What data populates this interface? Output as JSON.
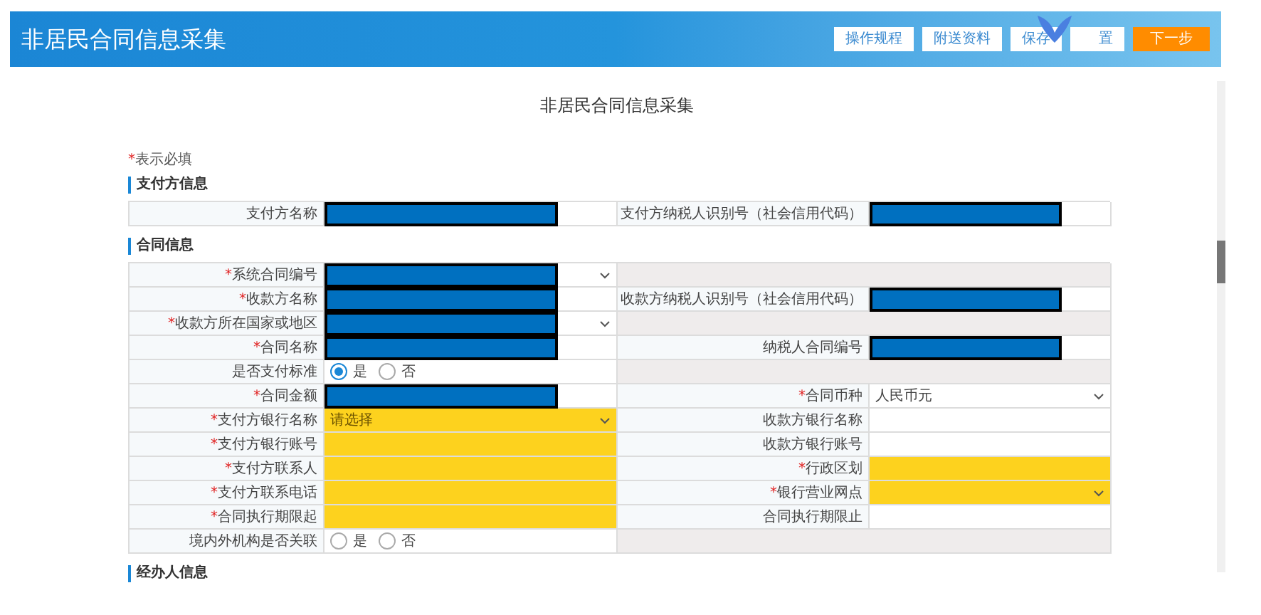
{
  "header": {
    "title": "非居民合同信息采集",
    "buttons": [
      {
        "label": "操作规程",
        "kind": "plain"
      },
      {
        "label": "附送资料",
        "kind": "plain"
      },
      {
        "label": "保存",
        "kind": "plain"
      },
      {
        "label": "置",
        "kind": "covered"
      },
      {
        "label": "下一步",
        "kind": "primary"
      }
    ]
  },
  "page_title": "非居民合同信息采集",
  "required_note": {
    "mark": "*",
    "text": "表示必填"
  },
  "sections": [
    {
      "title": "支付方信息",
      "rows": [
        [
          {
            "kind": "input",
            "label": "支付方名称",
            "redacted": true,
            "highlighted": false
          },
          {
            "kind": "input",
            "label": "支付方纳税人识别号（社会信用代码）",
            "redacted": true,
            "highlighted": false
          }
        ]
      ]
    },
    {
      "title": "合同信息",
      "rows": [
        [
          {
            "kind": "select",
            "label": "系统合同编号",
            "required_mark": "*",
            "redacted": true,
            "highlighted": false
          },
          {
            "kind": "blank"
          }
        ],
        [
          {
            "kind": "input",
            "label": "收款方名称",
            "required_mark": "*",
            "redacted": true,
            "highlighted": false
          },
          {
            "kind": "input",
            "label": "收款方纳税人识别号（社会信用代码）",
            "redacted": true,
            "highlighted": false
          }
        ],
        [
          {
            "kind": "select",
            "label": "收款方所在国家或地区",
            "required_mark": "*",
            "redacted": true,
            "highlighted": false
          },
          {
            "kind": "blank"
          }
        ],
        [
          {
            "kind": "input",
            "label": "合同名称",
            "required_mark": "*",
            "redacted": true,
            "highlighted": false
          },
          {
            "kind": "input",
            "label": "纳税人合同编号",
            "redacted": true,
            "highlighted": false
          }
        ],
        [
          {
            "kind": "radio",
            "label": "是否支付标准",
            "options": [
              {
                "label": "是",
                "selected": true
              },
              {
                "label": "否",
                "selected": false
              }
            ]
          },
          {
            "kind": "blank"
          }
        ],
        [
          {
            "kind": "input",
            "label": "合同金额",
            "required_mark": "*",
            "redacted": true,
            "highlighted": false
          },
          {
            "kind": "select",
            "label": "合同币种",
            "required_mark": "*",
            "value": "人民币元",
            "redacted": false,
            "highlighted": false
          }
        ],
        [
          {
            "kind": "select",
            "label": "支付方银行名称",
            "required_mark": "*",
            "value": "请选择",
            "redacted": false,
            "highlighted": true
          },
          {
            "kind": "input",
            "label": "收款方银行名称",
            "redacted": false,
            "highlighted": false
          }
        ],
        [
          {
            "kind": "input",
            "label": "支付方银行账号",
            "required_mark": "*",
            "redacted": false,
            "highlighted": true
          },
          {
            "kind": "input",
            "label": "收款方银行账号",
            "redacted": false,
            "highlighted": false
          }
        ],
        [
          {
            "kind": "input",
            "label": "支付方联系人",
            "required_mark": "*",
            "redacted": false,
            "highlighted": true
          },
          {
            "kind": "input",
            "label": "行政区划",
            "required_mark": "*",
            "redacted": false,
            "highlighted": true
          }
        ],
        [
          {
            "kind": "input",
            "label": "支付方联系电话",
            "required_mark": "*",
            "redacted": false,
            "highlighted": true
          },
          {
            "kind": "select",
            "label": "银行营业网点",
            "required_mark": "*",
            "redacted": false,
            "highlighted": true
          }
        ],
        [
          {
            "kind": "input",
            "label": "合同执行期限起",
            "required_mark": "*",
            "redacted": false,
            "highlighted": true
          },
          {
            "kind": "input",
            "label": "合同执行期限止",
            "redacted": false,
            "highlighted": false
          }
        ],
        [
          {
            "kind": "radio",
            "label": "境内外机构是否关联",
            "options": [
              {
                "label": "是",
                "selected": false
              },
              {
                "label": "否",
                "selected": false
              }
            ]
          },
          {
            "kind": "blank"
          }
        ]
      ]
    },
    {
      "title": "经办人信息"
    }
  ]
}
